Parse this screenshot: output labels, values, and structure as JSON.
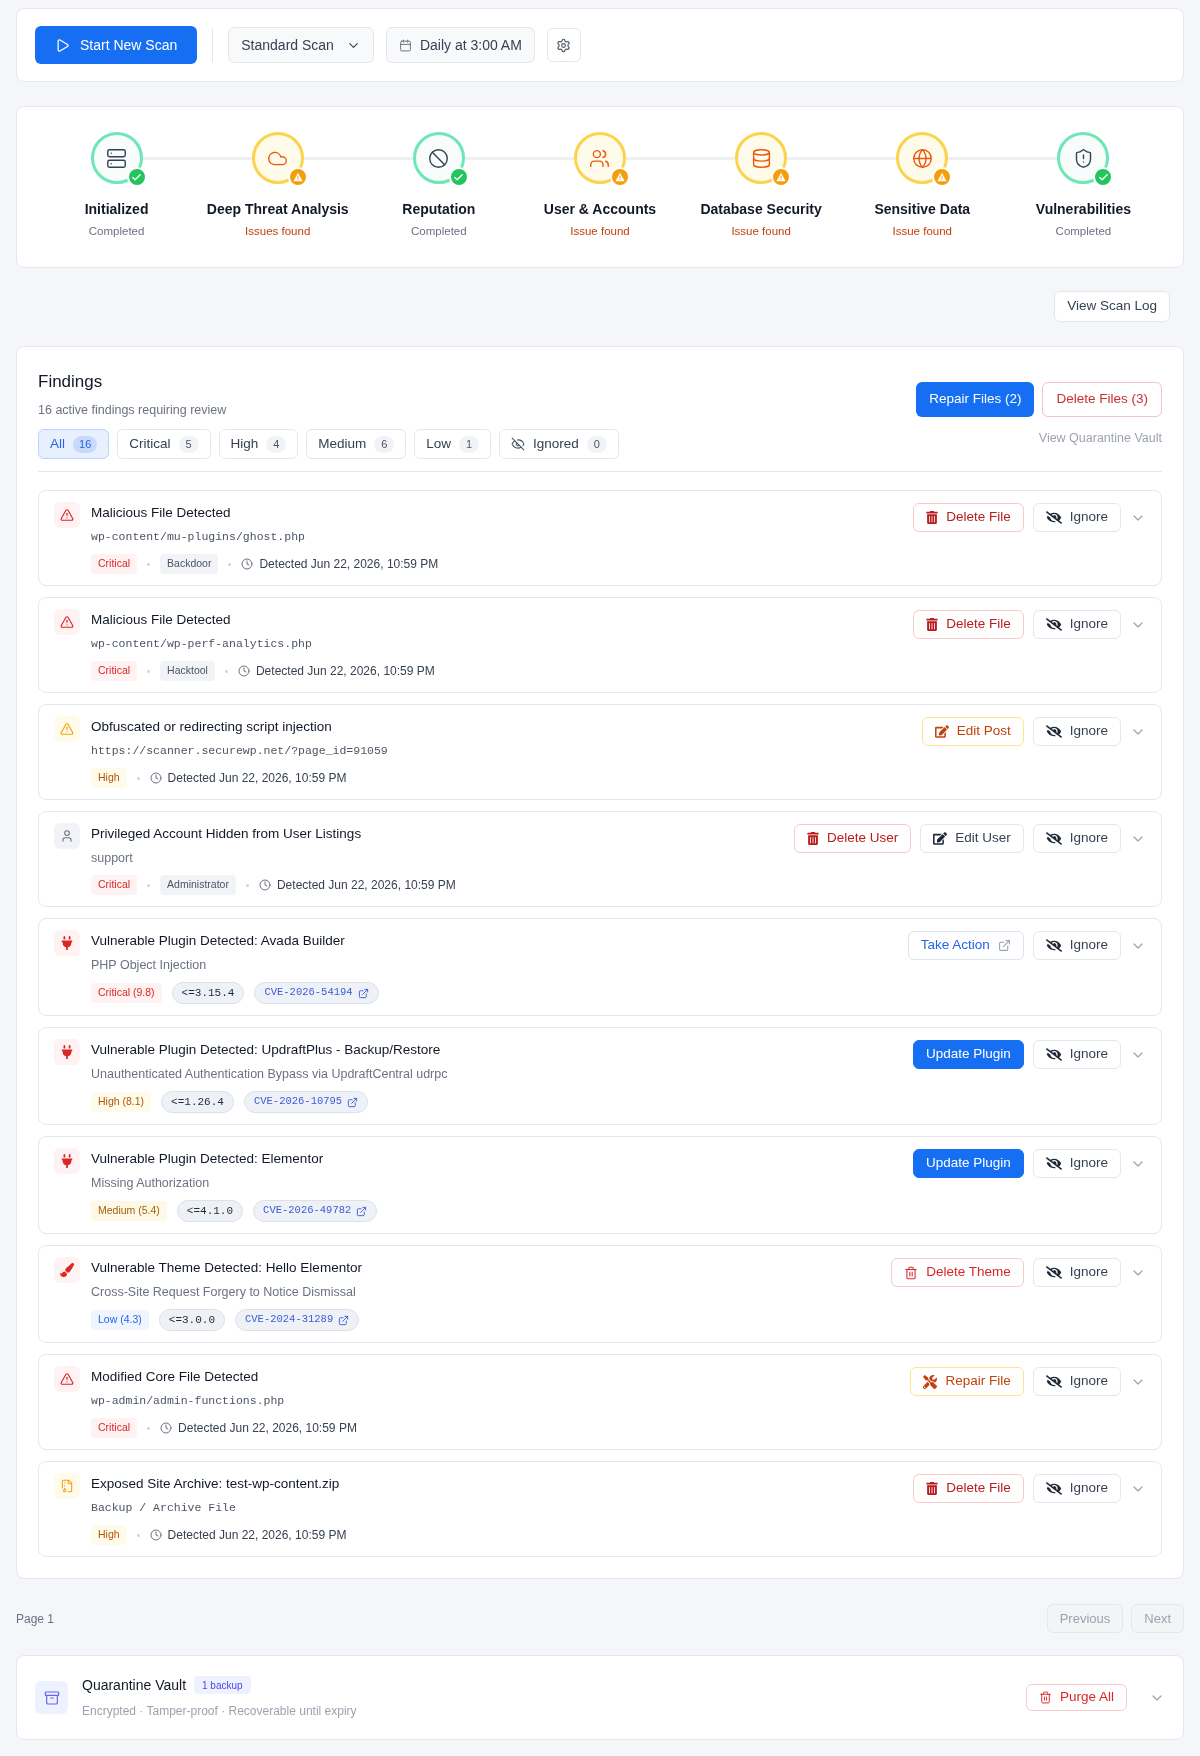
{
  "toolbar": {
    "start_button": "Start New Scan",
    "scan_type": "Standard Scan",
    "schedule": "Daily at 3:00 AM"
  },
  "steps": [
    {
      "label": "Initialized",
      "status_text": "Completed",
      "issues_found": false
    },
    {
      "label": "Deep Threat Analysis",
      "status_text": "Issues found",
      "issues_found": true
    },
    {
      "label": "Reputation",
      "status_text": "Completed",
      "issues_found": false
    },
    {
      "label": "User & Accounts",
      "status_text": "Issue found",
      "issues_found": true
    },
    {
      "label": "Database Security",
      "status_text": "Issue found",
      "issues_found": true
    },
    {
      "label": "Sensitive Data",
      "status_text": "Issue found",
      "issues_found": true
    },
    {
      "label": "Vulnerabilities",
      "status_text": "Completed",
      "issues_found": false
    }
  ],
  "scan_log_button": "View Scan Log",
  "findings": {
    "title": "Findings",
    "subtitle": "16 active findings requiring review",
    "filters": [
      {
        "kind": "plain",
        "label": "All",
        "count": "16",
        "selected": true
      },
      {
        "kind": "plain",
        "label": "Critical",
        "count": "5",
        "selected": false
      },
      {
        "kind": "plain",
        "label": "High",
        "count": "4",
        "selected": false
      },
      {
        "kind": "plain",
        "label": "Medium",
        "count": "6",
        "selected": false
      },
      {
        "kind": "plain",
        "label": "Low",
        "count": "1",
        "selected": false
      },
      {
        "kind": "ignored",
        "label": "Ignored",
        "count": "0",
        "selected": false
      }
    ],
    "repair_button": "Repair Files (2)",
    "delete_button": "Delete Files (3)",
    "vault_link": "View Quarantine Vault",
    "items": [
      {
        "kind": "alert",
        "title": "Malicious File Detected",
        "detail": {
          "kind": "path",
          "text": "wp-content/mu-plugins/ghost.php"
        },
        "tags": [
          {
            "kind": "critical",
            "text": "Critical"
          },
          {
            "kind": "category",
            "text": "Backdoor"
          }
        ],
        "detected": "Detected Jun 22, 2026, 10:59 PM",
        "actions": [
          {
            "kind": "delete",
            "label": "Delete File"
          },
          {
            "kind": "ignore",
            "label": "Ignore"
          }
        ],
        "expanded": false
      },
      {
        "kind": "alert",
        "title": "Malicious File Detected",
        "detail": {
          "kind": "path",
          "text": "wp-content/wp-perf-analytics.php"
        },
        "tags": [
          {
            "kind": "critical",
            "text": "Critical"
          },
          {
            "kind": "category",
            "text": "Hacktool"
          }
        ],
        "detected": "Detected Jun 22, 2026, 10:59 PM",
        "actions": [
          {
            "kind": "delete",
            "label": "Delete File"
          },
          {
            "kind": "ignore",
            "label": "Ignore"
          }
        ],
        "expanded": false
      },
      {
        "kind": "caution",
        "title": "Obfuscated or redirecting script injection",
        "detail": {
          "kind": "path",
          "text": "https://scanner.securewp.net/?page_id=91059"
        },
        "tags": [
          {
            "kind": "high",
            "text": "High"
          }
        ],
        "detected": "Detected Jun 22, 2026, 10:59 PM",
        "actions": [
          {
            "kind": "edit-warning",
            "label": "Edit Post"
          },
          {
            "kind": "ignore",
            "label": "Ignore"
          }
        ],
        "expanded": false
      },
      {
        "kind": "user",
        "title": "Privileged Account Hidden from User Listings",
        "detail": {
          "kind": "text",
          "text": "support"
        },
        "tags": [
          {
            "kind": "critical",
            "text": "Critical"
          },
          {
            "kind": "category",
            "text": "Administrator"
          }
        ],
        "detected": "Detected Jun 22, 2026, 10:59 PM",
        "actions": [
          {
            "kind": "delete",
            "label": "Delete User"
          },
          {
            "kind": "edit",
            "label": "Edit User"
          },
          {
            "kind": "ignore",
            "label": "Ignore"
          }
        ],
        "expanded": false
      },
      {
        "kind": "plugin",
        "title": "Vulnerable Plugin Detected: Avada Builder",
        "detail": {
          "kind": "text",
          "text": "PHP Object Injection"
        },
        "tags": [
          {
            "kind": "critical",
            "text": "Critical (9.8)"
          },
          {
            "kind": "version",
            "text": "<=3.15.4"
          },
          {
            "kind": "cve",
            "text": "CVE-2026-54194"
          }
        ],
        "actions": [
          {
            "kind": "external",
            "label": "Take Action"
          },
          {
            "kind": "ignore",
            "label": "Ignore"
          }
        ],
        "expanded": false
      },
      {
        "kind": "plugin",
        "title": "Vulnerable Plugin Detected: UpdraftPlus - Backup/Restore",
        "detail": {
          "kind": "text",
          "text": "Unauthenticated Authentication Bypass via UpdraftCentral udrpc"
        },
        "tags": [
          {
            "kind": "high",
            "text": "High (8.1)"
          },
          {
            "kind": "version",
            "text": "<=1.26.4"
          },
          {
            "kind": "cve",
            "text": "CVE-2026-10795"
          }
        ],
        "actions": [
          {
            "kind": "update",
            "label": "Update Plugin"
          },
          {
            "kind": "ignore",
            "label": "Ignore"
          }
        ],
        "expanded": false
      },
      {
        "kind": "plugin",
        "title": "Vulnerable Plugin Detected: Elementor",
        "detail": {
          "kind": "text",
          "text": "Missing Authorization"
        },
        "tags": [
          {
            "kind": "medium",
            "text": "Medium (5.4)"
          },
          {
            "kind": "version",
            "text": "<=4.1.0"
          },
          {
            "kind": "cve",
            "text": "CVE-2026-49782"
          }
        ],
        "actions": [
          {
            "kind": "update",
            "label": "Update Plugin"
          },
          {
            "kind": "ignore",
            "label": "Ignore"
          }
        ],
        "expanded": false
      },
      {
        "kind": "theme",
        "title": "Vulnerable Theme Detected: Hello Elementor",
        "detail": {
          "kind": "text",
          "text": "Cross-Site Request Forgery to Notice Dismissal"
        },
        "tags": [
          {
            "kind": "low",
            "text": "Low (4.3)"
          },
          {
            "kind": "version",
            "text": "<=3.0.0"
          },
          {
            "kind": "cve",
            "text": "CVE-2024-31289"
          }
        ],
        "actions": [
          {
            "kind": "delete-outline",
            "label": "Delete Theme"
          },
          {
            "kind": "ignore",
            "label": "Ignore"
          }
        ],
        "expanded": false
      },
      {
        "kind": "alert",
        "title": "Modified Core File Detected",
        "detail": {
          "kind": "path",
          "text": "wp-admin/admin-functions.php"
        },
        "tags": [
          {
            "kind": "critical",
            "text": "Critical"
          }
        ],
        "detected": "Detected Jun 22, 2026, 10:59 PM",
        "actions": [
          {
            "kind": "repair",
            "label": "Repair File"
          },
          {
            "kind": "ignore",
            "label": "Ignore"
          }
        ],
        "expanded": false
      },
      {
        "kind": "archive",
        "title": "Exposed Site Archive: test-wp-content.zip",
        "detail": {
          "kind": "path",
          "text": "Backup / Archive File"
        },
        "tags": [
          {
            "kind": "high",
            "text": "High"
          }
        ],
        "detected": "Detected Jun 22, 2026, 10:59 PM",
        "actions": [
          {
            "kind": "delete",
            "label": "Delete File"
          },
          {
            "kind": "ignore",
            "label": "Ignore"
          }
        ],
        "expanded": false
      }
    ]
  },
  "pagination": {
    "label": "Page 1",
    "buttons": [
      {
        "label": "Previous",
        "disabled": true
      },
      {
        "label": "Next",
        "disabled": true
      }
    ]
  },
  "vault": {
    "title": "Quarantine Vault",
    "badge": "1 backup",
    "subtitle": "Encrypted · Tamper-proof · Recoverable until expiry",
    "button": "Purge All",
    "expanded": false
  }
}
